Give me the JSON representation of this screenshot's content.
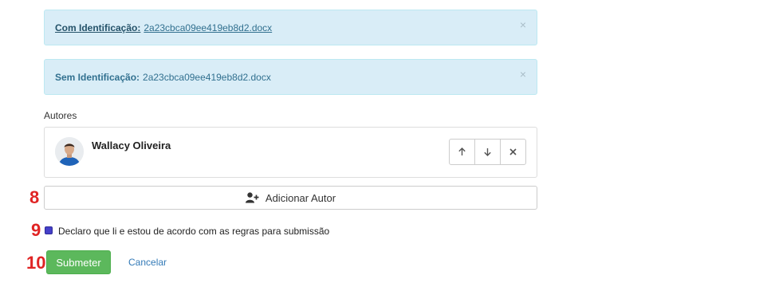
{
  "files": [
    {
      "label": "Com Identificação:",
      "filename": "2a23cbca09ee419eb8d2.docx",
      "close_glyph": "×"
    },
    {
      "label": "Sem Identificação:",
      "filename": "2a23cbca09ee419eb8d2.docx",
      "close_glyph": "×"
    }
  ],
  "authors_section": {
    "label": "Autores",
    "authors": [
      {
        "name": "Wallacy Oliveira"
      }
    ],
    "controls": {
      "up_icon": "arrow-up-icon",
      "down_icon": "arrow-down-icon",
      "remove_icon": "close-icon"
    }
  },
  "step_numbers": [
    "8",
    "9",
    "10"
  ],
  "add_author": {
    "label": "Adicionar Autor",
    "icon": "user-plus-icon"
  },
  "agreement": {
    "text": "Declaro que li e estou de acordo com as regras para submissão",
    "checked": true
  },
  "actions": {
    "submit_label": "Submeter",
    "cancel_label": "Cancelar"
  },
  "colors": {
    "alert_bg": "#d9edf7",
    "alert_text": "#31708f",
    "step_number": "#e02424",
    "submit_bg": "#5cb85c",
    "link": "#337ab7",
    "checkbox": "#4540c9"
  }
}
